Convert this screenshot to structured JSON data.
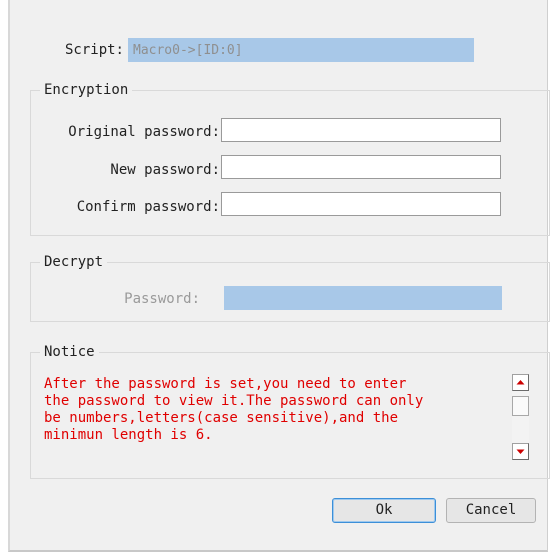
{
  "script": {
    "label": "Script:",
    "value": "Macro0->[ID:0]"
  },
  "encryption": {
    "title": "Encryption",
    "original_password_label": "Original password:",
    "new_password_label": "New password:",
    "confirm_password_label": "Confirm password:",
    "original_password_value": "",
    "new_password_value": "",
    "confirm_password_value": ""
  },
  "decrypt": {
    "title": "Decrypt",
    "password_label": "Password:",
    "password_value": ""
  },
  "notice": {
    "title": "Notice",
    "line1": "After the password is set,you need to enter",
    "line2": "the password to view it.The password can only",
    "line3": "be numbers,letters(case sensitive),and the",
    "line4": "minimun length is 6."
  },
  "buttons": {
    "ok": "Ok",
    "cancel": "Cancel"
  },
  "colors": {
    "dialog_bg": "#f0f0f0",
    "readonly_field_bg": "#a8c8e8",
    "notice_text": "#e00000",
    "default_button_border": "#3c8fd8"
  },
  "icons": {
    "scroll_up": "arrow-up-icon",
    "scroll_down": "arrow-down-icon"
  }
}
